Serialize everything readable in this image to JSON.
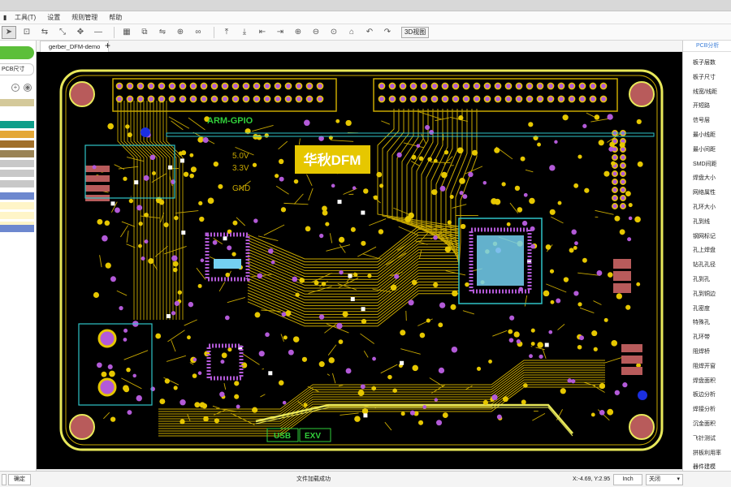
{
  "menu": [
    "工具(T)",
    "设置",
    "规则管理",
    "帮助"
  ],
  "document_tab": "gerber_DFM-demo",
  "left_panel": {
    "board_size_label": "PCB尺寸",
    "layer_colors": [
      "#d4c99a",
      "#ffffff",
      "#0e9e8a",
      "#e4a838",
      "#a06f2a",
      "#9a8355",
      "#c8c8c8",
      "#c8c8c8",
      "#c8c8c8",
      "#6d88cf",
      "#fff5c8",
      "#fff5c8",
      "#fff5c8",
      "#6d88cf"
    ]
  },
  "toolbar": {
    "view3d_label": "3D视图"
  },
  "board": {
    "labels": [
      "ARM-GPIO",
      "5.0V",
      "3.3V",
      "GND",
      "USB",
      "EXV"
    ],
    "logo_text": "华秋DFM",
    "colors": {
      "trace": "#c8a800",
      "pad": "#e6c700",
      "outline": "#e8e85a",
      "silk": "#31ce3a",
      "via": "#b35ad8",
      "smd": "#74d0f0",
      "copper": "#b85b5b",
      "cyan": "#2fc4c8"
    }
  },
  "right_panel": {
    "header": "PCB分析",
    "items": [
      "板子层数",
      "板子尺寸",
      "线宽/线距",
      "开短路",
      "信号层",
      "最小线距",
      "最小间距",
      "SMD间距",
      "焊盘大小",
      "网络属性",
      "孔环大小",
      "孔到线",
      "钢网标记",
      "孔上焊盘",
      "钻孔孔径",
      "孔到孔",
      "孔到铜边",
      "孔密度",
      "特殊孔",
      "孔环带",
      "阻焊桥",
      "阻焊开窗",
      "焊盘面积",
      "板边分析",
      "焊接分析",
      "沉金面积",
      "飞针测试",
      "拼板利用率",
      "器件建模"
    ]
  },
  "status": {
    "left_button": "确定",
    "message": "文件加载成功",
    "coords": "X:-4.69, Y:2.95",
    "unit": "Inch",
    "mode": "关闭"
  }
}
